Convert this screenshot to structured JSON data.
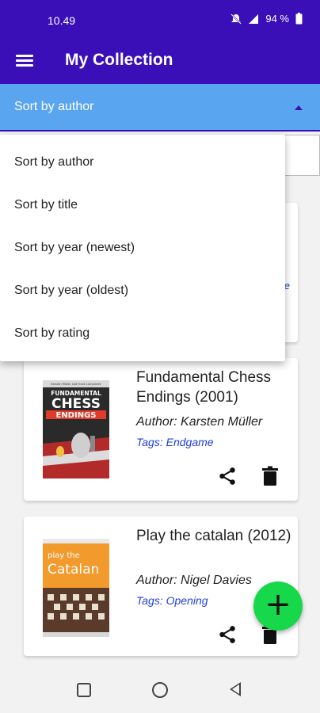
{
  "status_bar": {
    "time": "10.49",
    "battery": "94 %",
    "icons": [
      "mute-icon",
      "signal-icon",
      "battery-icon"
    ]
  },
  "app_bar": {
    "title": "My Collection",
    "menu_icon": "menu-icon"
  },
  "sort": {
    "selected": "Sort by author",
    "options": [
      "Sort by author",
      "Sort by title",
      "Sort by year (newest)",
      "Sort by year (oldest)",
      "Sort by rating"
    ]
  },
  "books": [
    {
      "title": "Fundamental Chess Endings (2001)",
      "author": "Author: Karsten Müller",
      "tags": "Tags: Endgame",
      "cover_header": "Karsten Müller and Frank Lamprecht",
      "cover_title": "FUNDAMENTAL CHESS ENDINGS"
    },
    {
      "title": "Play the catalan (2012)",
      "author": "Author: Nigel Davies",
      "tags": "Tags: Opening",
      "cover_title_1": "play the",
      "cover_title_2": "Catalan"
    }
  ],
  "colors": {
    "primary": "#3a0fb8",
    "sort_bar": "#5aa5f0",
    "fab": "#17d84a",
    "tag_text": "#1f3fd8"
  },
  "fab": {
    "label": "+"
  }
}
